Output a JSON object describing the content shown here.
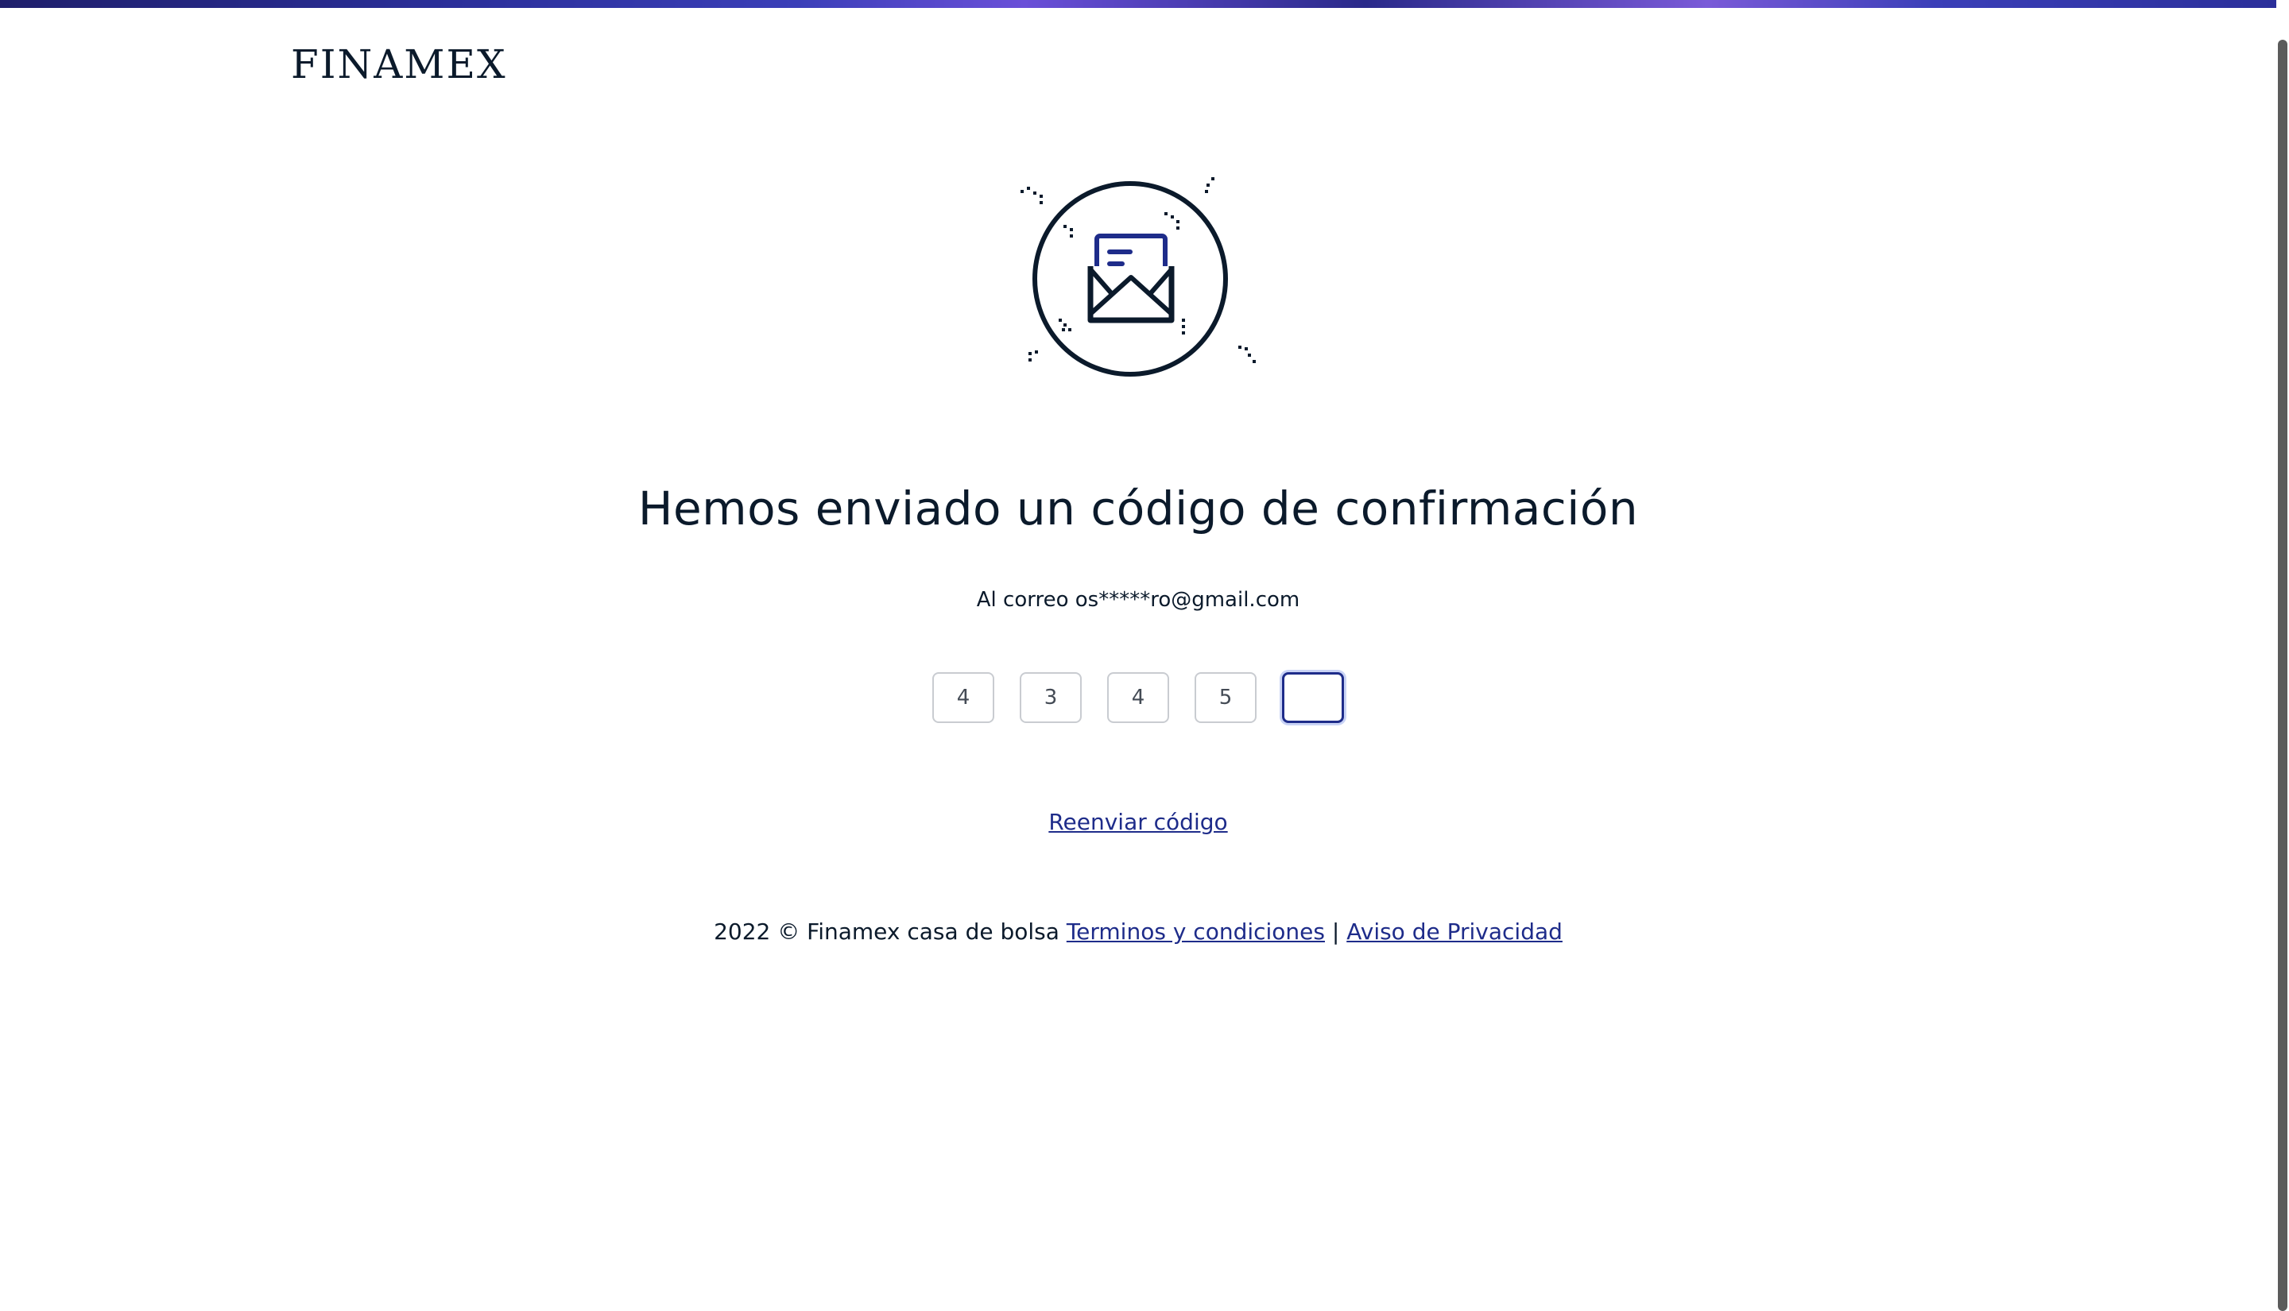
{
  "brand": {
    "logo_text": "FINAMEX",
    "accent_color": "#1e2c8a",
    "text_color": "#0b1a2b"
  },
  "illustration": {
    "icon": "envelope-open-icon"
  },
  "main": {
    "title": "Hemos enviado un código de confirmación",
    "email_line": "Al correo os*****ro@gmail.com",
    "code_digits": [
      "4",
      "3",
      "4",
      "5",
      ""
    ],
    "resend_label": "Reenviar código"
  },
  "footer": {
    "copyright": "2022 © Finamex casa de bolsa",
    "terms_label": "Terminos y condiciones",
    "separator": "|",
    "privacy_label": "Aviso de Privacidad"
  }
}
